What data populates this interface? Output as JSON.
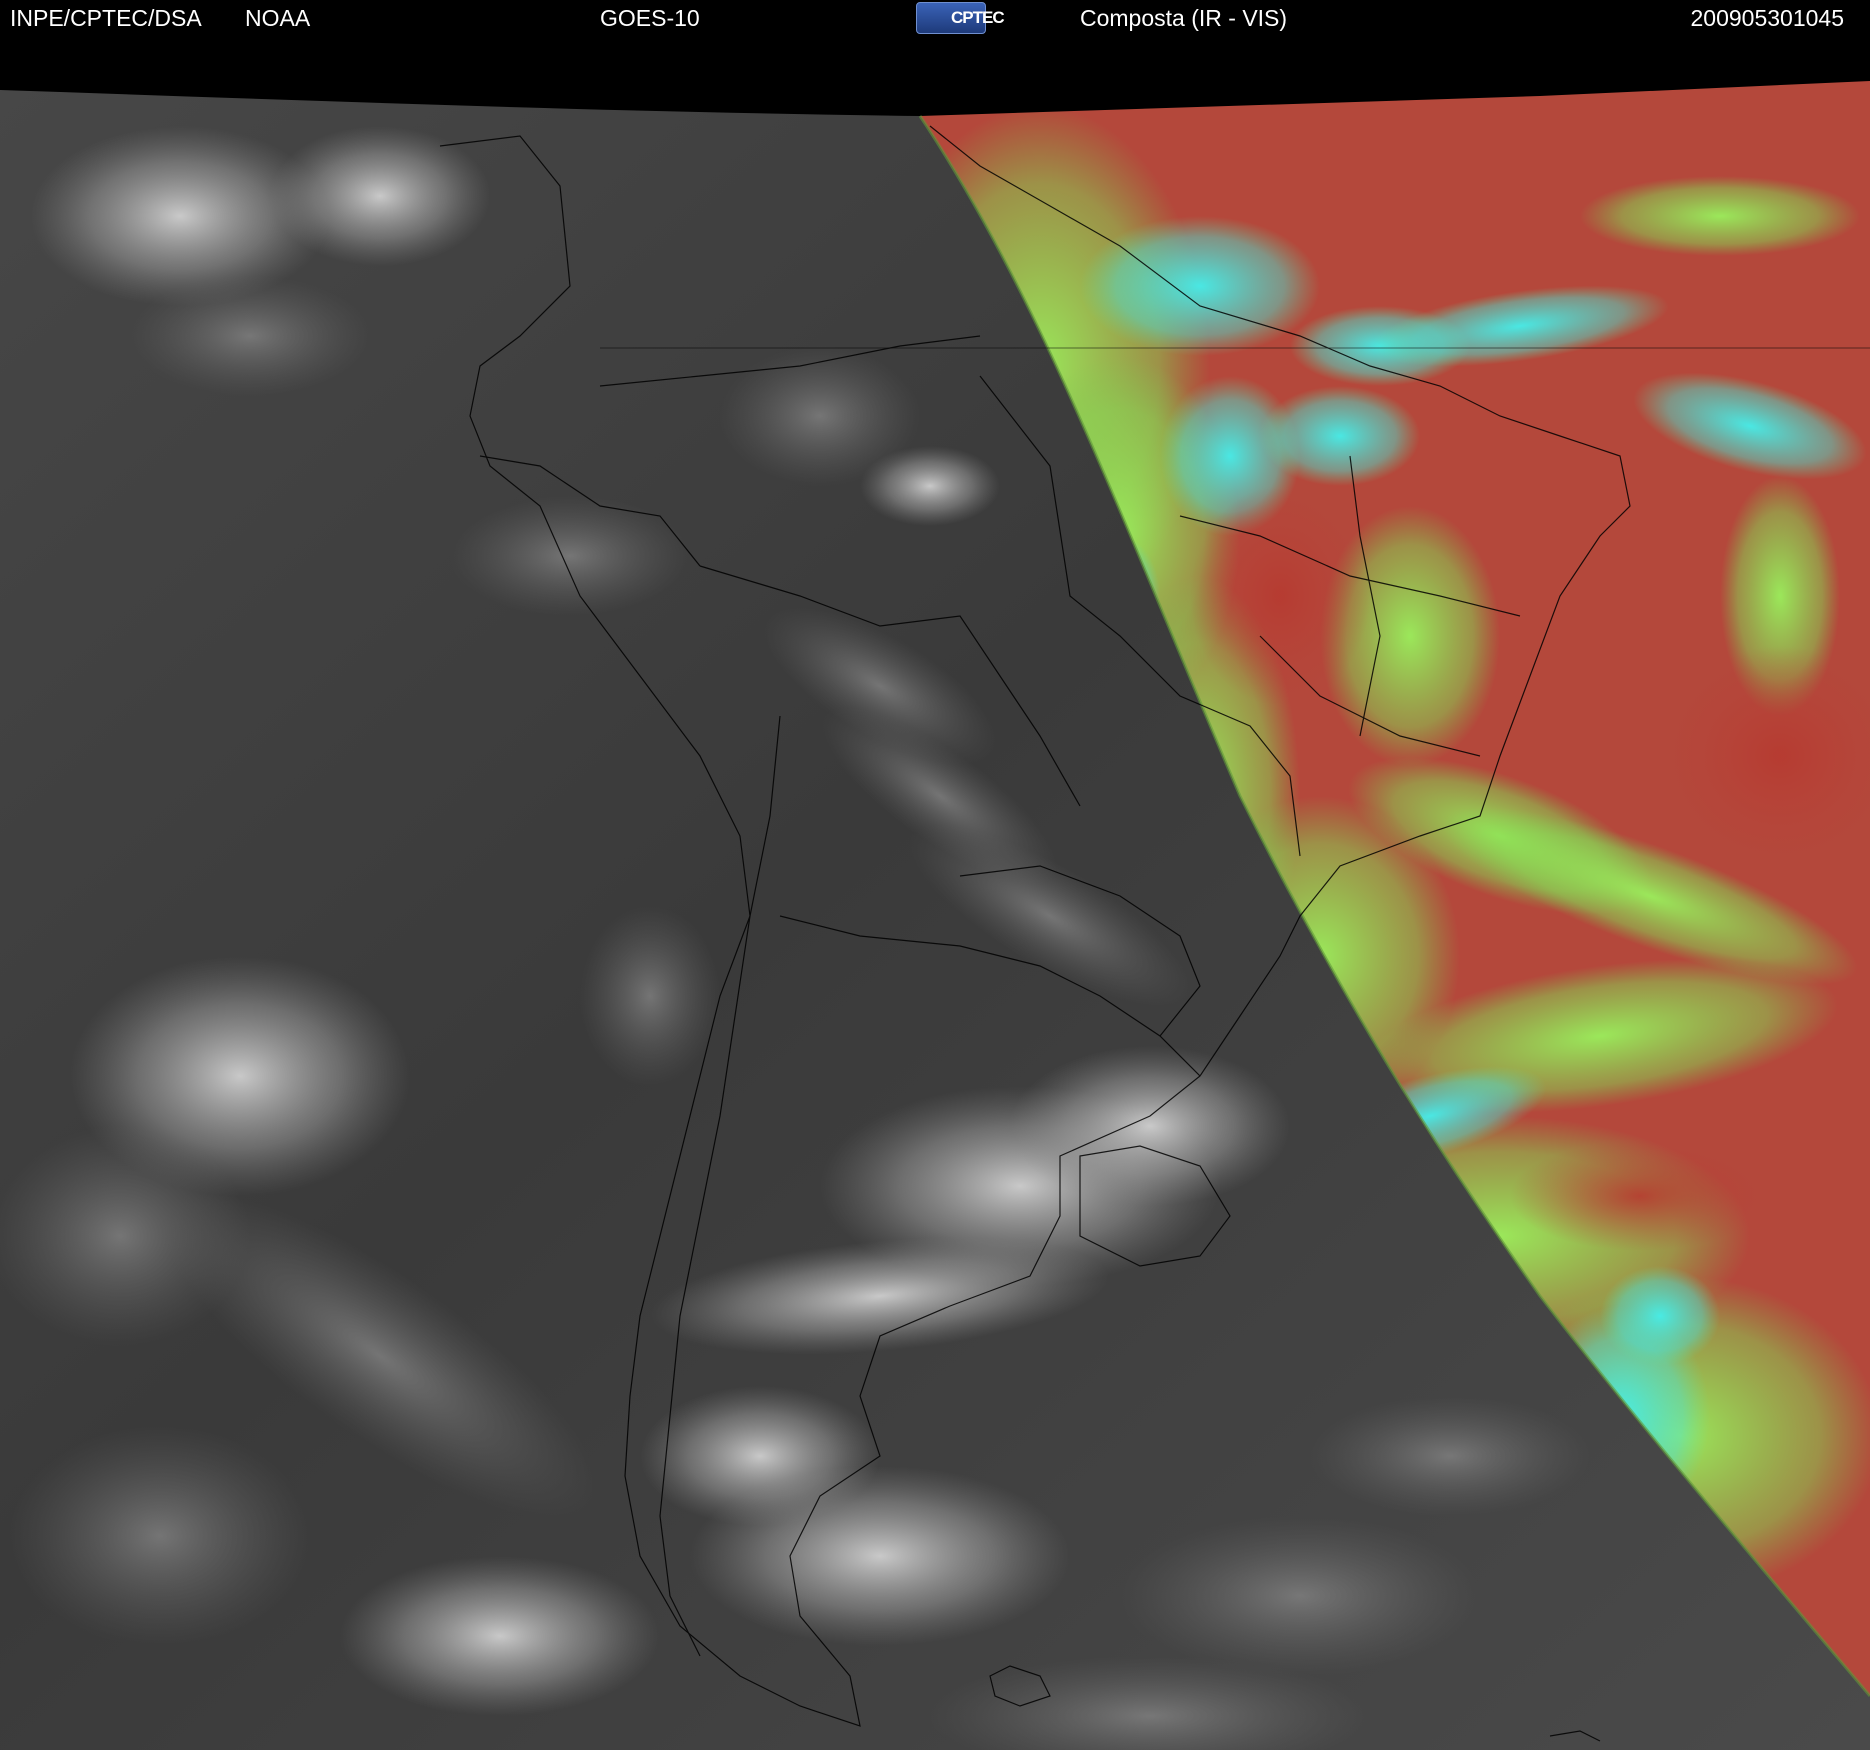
{
  "header": {
    "agency": "INPE/CPTEC/DSA",
    "noaa": "NOAA",
    "satellite": "GOES-10",
    "logo_text": "CPTEC",
    "product": "Composta (IR - VIS)",
    "datetime": "200905301045"
  },
  "colors": {
    "background": "#000000",
    "header_text": "#ffffff",
    "ir_gray_dark": "#2f2f2f",
    "ir_gray_light": "#bdbdbd",
    "vis_red": "#b9463a",
    "vis_green": "#8ee65a",
    "vis_cyan": "#38e6e0",
    "borders": "#000000"
  }
}
